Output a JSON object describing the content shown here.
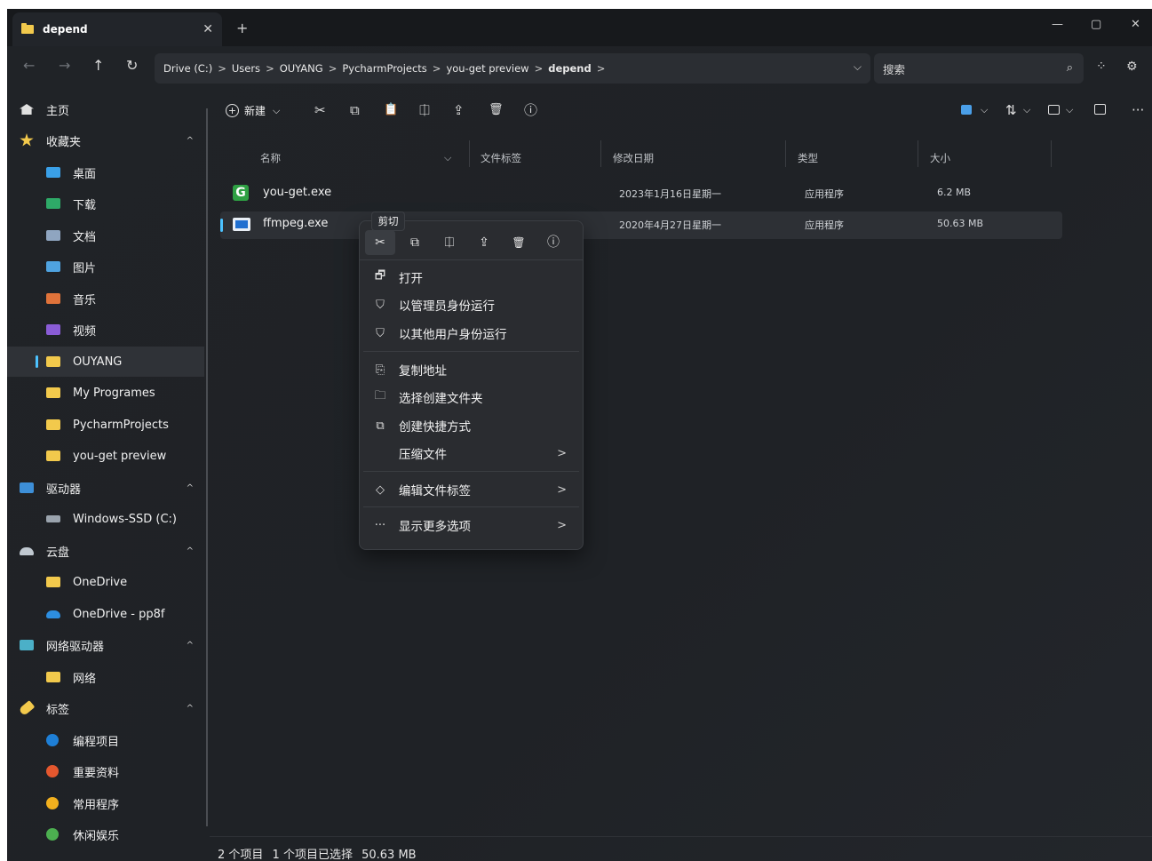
{
  "tab": {
    "title": "depend",
    "close": "✕",
    "new_tab": "+"
  },
  "window_controls": {
    "minimize": "—",
    "maximize": "▢",
    "close": "✕"
  },
  "nav": {
    "back": "←",
    "forward": "→",
    "up": "↑",
    "refresh": "↻"
  },
  "breadcrumb": [
    "Drive (C:)",
    "Users",
    "OUYANG",
    "PycharmProjects",
    "you-get preview",
    "depend"
  ],
  "breadcrumb_sep": ">",
  "breadcrumb_dropdown": "⌵",
  "search": {
    "placeholder": "搜索",
    "icon": "⌕"
  },
  "nav_extra": {
    "sparkle": "⁘",
    "settings": "⚙"
  },
  "sidebar": {
    "items": [
      {
        "label": "主页",
        "icon": "home-icon"
      },
      {
        "label": "收藏夹",
        "icon": "star-icon",
        "chevron": "^"
      },
      {
        "label": "桌面",
        "icon": "desktop-icon"
      },
      {
        "label": "下载",
        "icon": "download-icon"
      },
      {
        "label": "文档",
        "icon": "documents-icon"
      },
      {
        "label": "图片",
        "icon": "pictures-icon"
      },
      {
        "label": "音乐",
        "icon": "music-icon"
      },
      {
        "label": "视频",
        "icon": "videos-icon"
      },
      {
        "label": "OUYANG",
        "icon": "folder-icon"
      },
      {
        "label": "My Programes",
        "icon": "folder-icon"
      },
      {
        "label": "PycharmProjects",
        "icon": "folder-icon"
      },
      {
        "label": "you-get preview",
        "icon": "folder-icon"
      },
      {
        "label": "驱动器",
        "icon": "pc-icon",
        "chevron": "^"
      },
      {
        "label": "Windows-SSD (C:)",
        "icon": "drive-icon"
      },
      {
        "label": "云盘",
        "icon": "cloud-icon",
        "chevron": "^"
      },
      {
        "label": "OneDrive",
        "icon": "folder-icon"
      },
      {
        "label": "OneDrive - pp8f",
        "icon": "onedrive-icon"
      },
      {
        "label": "网络驱动器",
        "icon": "network-drive-icon",
        "chevron": "^"
      },
      {
        "label": "网络",
        "icon": "folder-icon"
      },
      {
        "label": "标签",
        "icon": "tag-icon",
        "chevron": "^"
      },
      {
        "label": "编程项目",
        "color": "#1e7fd6"
      },
      {
        "label": "重要资料",
        "color": "#e4572e"
      },
      {
        "label": "常用程序",
        "color": "#f2b01e"
      },
      {
        "label": "休闲娱乐",
        "color": "#4caf50"
      }
    ]
  },
  "toolbar": {
    "new_label": "新建",
    "new_plus": "+",
    "new_chev": "⌵",
    "cut": "✂",
    "copy": "⧉",
    "paste": "📋",
    "rename": "⎅",
    "share": "⇪",
    "delete": "🗑",
    "info": "ⓘ",
    "view_chev": "⌵",
    "sort": "⇅",
    "more": "···"
  },
  "columns": {
    "name": "名称",
    "tags": "文件标签",
    "modified": "修改日期",
    "type": "类型",
    "size": "大小"
  },
  "files": [
    {
      "name": "you-get.exe",
      "modified": "2023年1月16日星期一",
      "type": "应用程序",
      "size": "6.2 MB",
      "icon_letter": "G"
    },
    {
      "name": "ffmpeg.exe",
      "modified": "2020年4月27日星期一",
      "type": "应用程序",
      "size": "50.63 MB"
    }
  ],
  "tooltip": "剪切",
  "context_menu": {
    "items": [
      {
        "label": "打开",
        "icon": "🗗"
      },
      {
        "label": "以管理员身份运行",
        "icon": "⛉"
      },
      {
        "label": "以其他用户身份运行",
        "icon": "⛉"
      },
      {
        "label": "复制地址",
        "icon": "⎘"
      },
      {
        "label": "选择创建文件夹",
        "icon": "🗀"
      },
      {
        "label": "创建快捷方式",
        "icon": "⧉"
      },
      {
        "label": "压缩文件",
        "arrow": ">"
      },
      {
        "label": "编辑文件标签",
        "icon": "◇",
        "arrow": ">"
      },
      {
        "label": "显示更多选项",
        "icon": "···",
        "arrow": ">"
      }
    ]
  },
  "status": {
    "count": "2 个项目",
    "selected": "1 个项目已选择",
    "size": "50.63 MB"
  }
}
